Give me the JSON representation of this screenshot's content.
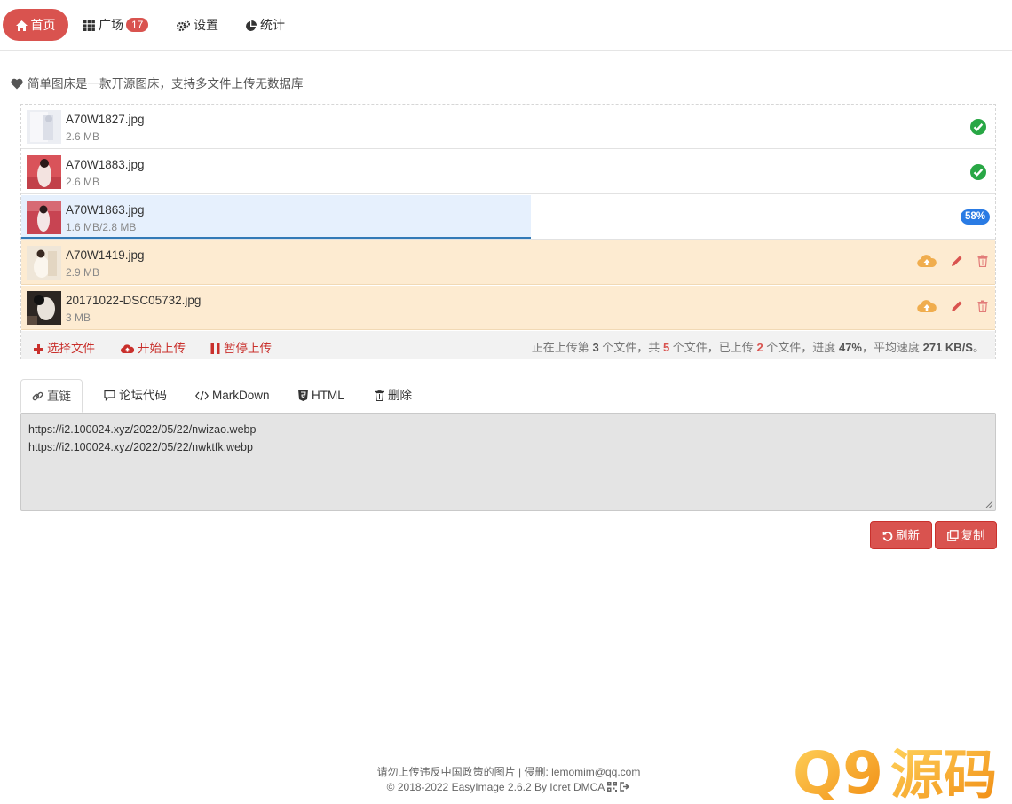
{
  "nav": {
    "home": "首页",
    "square": "广场",
    "square_badge": "17",
    "settings": "设置",
    "stats": "统计"
  },
  "intro": "简单图床是一款开源图床，支持多文件上传无数据库",
  "files": [
    {
      "name": "A70W1827.jpg",
      "size": "2.6 MB",
      "status": "done"
    },
    {
      "name": "A70W1883.jpg",
      "size": "2.6 MB",
      "status": "done"
    },
    {
      "name": "A70W1863.jpg",
      "size": "1.6 MB/2.8 MB",
      "status": "uploading",
      "progress_label": "58%",
      "progress": 0.58
    },
    {
      "name": "A70W1419.jpg",
      "size": "2.9 MB",
      "status": "queued"
    },
    {
      "name": "20171022-DSC05732.jpg",
      "size": "3 MB",
      "status": "queued"
    }
  ],
  "toolbar": {
    "select": "选择文件",
    "start": "开始上传",
    "pause": "暂停上传",
    "status_prefix": "正在上传第",
    "current_index": "3",
    "status_mid1": "个文件，共",
    "total": "5",
    "status_mid2": "个文件，已上传",
    "uploaded": "2",
    "status_mid3": "个文件，进度",
    "percent": "47%",
    "status_mid4": "，平均速度",
    "speed": "271 KB/S",
    "status_end": "。"
  },
  "tabs": [
    "直链",
    "论坛代码",
    "MarkDown",
    "HTML",
    "删除"
  ],
  "links": [
    "https://i2.100024.xyz/2022/05/22/nwizao.webp",
    "https://i2.100024.xyz/2022/05/22/nwktfk.webp"
  ],
  "buttons": {
    "refresh": "刷新",
    "copy": "复制"
  },
  "footer": {
    "line1": "请勿上传违反中国政策的图片 | 侵删: lemomim@qq.com",
    "line2": "© 2018-2022 EasyImage 2.6.2 By Icret DMCA"
  },
  "watermark": {
    "q9": "Q9",
    "yuanma": "源码"
  },
  "colors": {
    "accent_red": "#d9534f",
    "progress_blue": "#2a7be4",
    "success_green": "#28a745",
    "upload_orange": "#f0ad4e",
    "queued_bg": "#fdebd1"
  }
}
